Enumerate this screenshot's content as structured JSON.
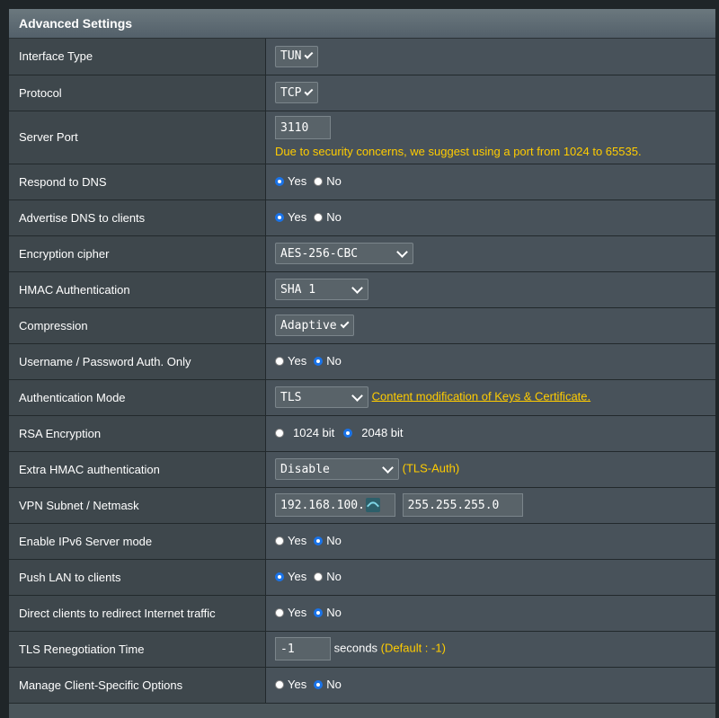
{
  "header": {
    "title": "Advanced Settings"
  },
  "rows": {
    "interface_type": {
      "label": "Interface Type",
      "value": "TUN"
    },
    "protocol": {
      "label": "Protocol",
      "value": "TCP"
    },
    "server_port": {
      "label": "Server Port",
      "value": "3110",
      "note": "Due to security concerns, we suggest using a port from 1024 to 65535."
    },
    "respond_dns": {
      "label": "Respond to DNS",
      "yes": "Yes",
      "no": "No",
      "selected": "Yes"
    },
    "advertise_dns": {
      "label": "Advertise DNS to clients",
      "yes": "Yes",
      "no": "No",
      "selected": "Yes"
    },
    "cipher": {
      "label": "Encryption cipher",
      "value": "AES-256-CBC"
    },
    "hmac": {
      "label": "HMAC Authentication",
      "value": "SHA 1"
    },
    "compression": {
      "label": "Compression",
      "value": "Adaptive"
    },
    "userpass_only": {
      "label": "Username / Password Auth. Only",
      "yes": "Yes",
      "no": "No",
      "selected": "No"
    },
    "auth_mode": {
      "label": "Authentication Mode",
      "value": "TLS",
      "link": "Content modification of Keys & Certificate."
    },
    "rsa": {
      "label": "RSA Encryption",
      "opt1": "1024 bit",
      "opt2": "2048 bit",
      "selected": "2048 bit"
    },
    "extra_hmac": {
      "label": "Extra HMAC authentication",
      "value": "Disable",
      "hint": "(TLS-Auth)"
    },
    "subnet": {
      "label": "VPN Subnet / Netmask",
      "subnet": "192.168.100.",
      "netmask": "255.255.255.0"
    },
    "ipv6": {
      "label": "Enable IPv6 Server mode",
      "yes": "Yes",
      "no": "No",
      "selected": "No"
    },
    "push_lan": {
      "label": "Push LAN to clients",
      "yes": "Yes",
      "no": "No",
      "selected": "Yes"
    },
    "redirect": {
      "label": "Direct clients to redirect Internet traffic",
      "yes": "Yes",
      "no": "No",
      "selected": "No"
    },
    "tls_reneg": {
      "label": "TLS Renegotiation Time",
      "value": "-1",
      "unit": "seconds",
      "hint": "(Default : -1)"
    },
    "client_specific": {
      "label": "Manage Client-Specific Options",
      "yes": "Yes",
      "no": "No",
      "selected": "No"
    }
  }
}
